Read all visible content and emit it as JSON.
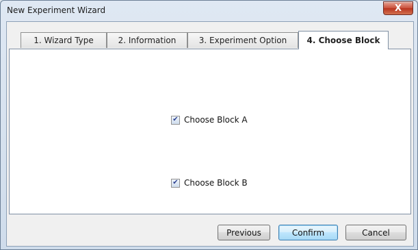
{
  "window": {
    "title": "New Experiment Wizard",
    "close_label": "X"
  },
  "tabs": [
    {
      "label": "1. Wizard Type"
    },
    {
      "label": "2. Information"
    },
    {
      "label": "3. Experiment Option"
    },
    {
      "label": "4. Choose Block",
      "active": true
    }
  ],
  "options": [
    {
      "label": "Choose Block A",
      "checked": true
    },
    {
      "label": "Choose Block B",
      "checked": true
    }
  ],
  "checkmark": "✔",
  "buttons": {
    "previous": "Previous",
    "confirm": "Confirm",
    "cancel": "Cancel"
  }
}
